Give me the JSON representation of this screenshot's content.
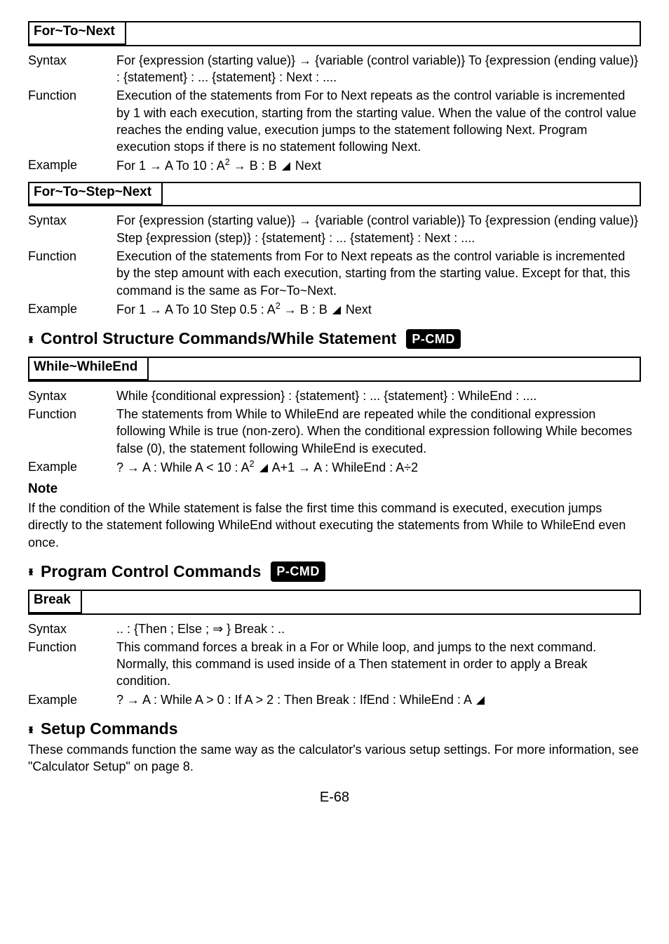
{
  "box1": {
    "title": "For~To~Next",
    "syntax": "For {expression (starting value)} → {variable (control variable)} To {expression (ending value)} : {statement} : ... {statement} : Next : ....",
    "function": "Execution of the statements from For to Next repeats as the control variable is incremented by 1 with each execution, starting from the starting value. When the value of the control value reaches the ending value, execution jumps to the statement following Next.  Program execution stops if there is no statement following Next.",
    "example_pre": "For 1 → A To 10 : A",
    "example_sup": "2",
    "example_post": " → B : B ",
    "example_tail": " Next"
  },
  "box2": {
    "title": "For~To~Step~Next",
    "syntax": "For {expression (starting value)} → {variable (control variable)} To {expression (ending value)} Step {expression (step)} : {statement} : ... {statement} : Next : ....",
    "function": "Execution of the statements from For to Next repeats as the control variable is incremented by the step amount with each execution, starting from the starting value. Except for that, this command is the same as For~To~Next.",
    "example_pre": "For 1 → A To 10 Step 0.5 : A",
    "example_sup": "2",
    "example_post": " → B : B ",
    "example_tail": " Next"
  },
  "heading1": "Control Structure Commands/While Statement",
  "pcmd": "P-CMD",
  "box3": {
    "title": "While~WhileEnd",
    "syntax": "While {conditional expression} : {statement} : ... {statement} : WhileEnd : ....",
    "function": "The statements from While to WhileEnd are repeated while the conditional expression following While is true (non-zero). When the conditional expression following While becomes false (0), the statement following WhileEnd is executed.",
    "example_pre": "? → A : While A < 10 : A",
    "example_sup": "2",
    "example_mid": " ",
    "example_post": " A+1 → A : WhileEnd : A÷2"
  },
  "note_heading": "Note",
  "note_body": "If the condition of the While statement is false the first time this command is executed, execution jumps directly to the statement following WhileEnd without executing the statements from While to WhileEnd even once.",
  "heading2": "Program Control Commands",
  "box4": {
    "title": "Break",
    "syntax": ".. : {Then ; Else ; ⇒ } Break : ..",
    "function": "This command forces a break in a For or While loop, and jumps to the next command. Normally, this command is used inside of a Then statement in order to apply a Break condition.",
    "example_pre": "? → A : While A > 0 : If A > 2 : Then Break : IfEnd : WhileEnd : A "
  },
  "heading3": "Setup Commands",
  "setup_body": "These commands function the same way as the calculator's various setup settings. For more information, see \"Calculator Setup\" on page 8.",
  "labels": {
    "syntax": "Syntax",
    "function": "Function",
    "example": "Example"
  },
  "page_num": "E-68"
}
